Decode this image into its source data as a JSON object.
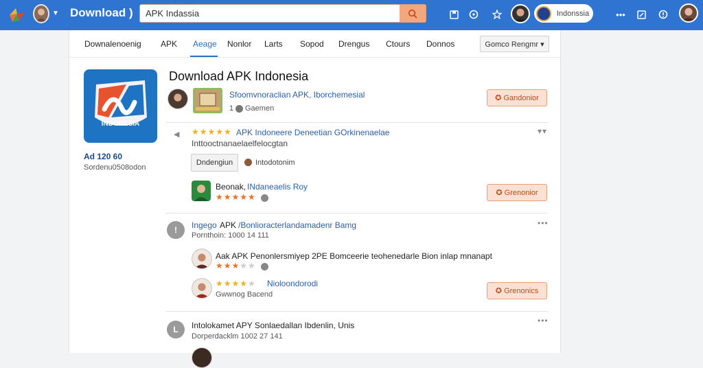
{
  "topbar": {
    "title": "Download )",
    "search_value": "APK Indassia",
    "chip_label": "Indonssia",
    "icons": [
      "logo-icon",
      "caret-down-icon",
      "search-icon",
      "save-icon",
      "help-icon",
      "star-icon",
      "more-icon",
      "edit-icon",
      "info-icon"
    ]
  },
  "nav": {
    "items": [
      "Downalenoenig",
      "APK",
      "Aeage",
      "Nonlor",
      "Larts",
      "Sopod",
      "Drengus",
      "Ctours",
      "Donnos"
    ],
    "active": "Aeage",
    "button": "Gomco Rengmr ▾"
  },
  "app": {
    "title": "Download APK Indonesia",
    "icon_label": "INDONESIA",
    "version": "Ad 120 60",
    "meta": "Sordenu0508odon"
  },
  "header_row": {
    "link": "Sfoomvnoraclian APK, Iborchemesial",
    "count": "1",
    "sub": "Gaemen",
    "button": "Gandonior"
  },
  "review1": {
    "stars": "★★★★★",
    "link": "APK Indoneere Deneetian GOrkinenaelae",
    "sub": "Inttooctnanaelaelfelocgtan",
    "tag_button": "Dndengiun",
    "tag_text": "Intodotonim",
    "user": "Beonak, ",
    "user_link": "INdaneaelis Roy",
    "button": "Grenonior"
  },
  "comment1": {
    "icon_text": "!",
    "title": "Ingego",
    "title_bold": "APK",
    "title_link": "/Bonlioracterlandamadenr Bamg",
    "sub": "Pornthoin: 1000 14 111",
    "reply1_text": "Aak APK Penonlersmiyep 2PE Bomceerie teohenedarle Bion inlap mnanapt",
    "reply2_link": "Nioloondorodi",
    "reply2_sub": "Gwwnog Bacend",
    "button": "Grenonics"
  },
  "comment2": {
    "icon_text": "L",
    "title": "Intolokamet APY Sonlaedallan Ibdenlin, Unis",
    "sub": "Dorperdacklm 1002 27 141"
  },
  "colors": {
    "topbar": "#2f74d0",
    "accent_orange": "#f3a77c",
    "link_blue": "#2a5fb0"
  }
}
